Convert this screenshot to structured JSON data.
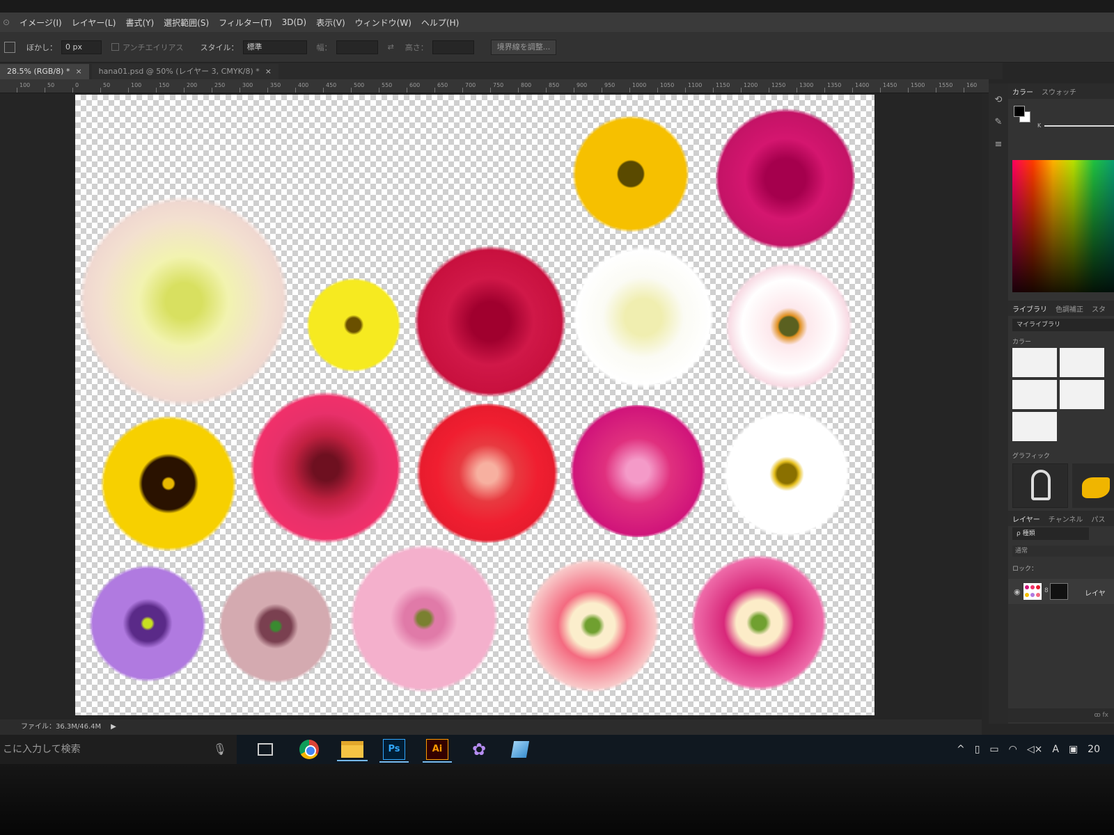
{
  "menu": {
    "items": [
      "イメージ(I)",
      "レイヤー(L)",
      "書式(Y)",
      "選択範囲(S)",
      "フィルター(T)",
      "3D(D)",
      "表示(V)",
      "ウィンドウ(W)",
      "ヘルプ(H)"
    ]
  },
  "options": {
    "feather_label": "ぼかし：",
    "feather_value": "0 px",
    "antialias_label": "アンチエイリアス",
    "style_label": "スタイル：",
    "style_value": "標準",
    "width_label": "幅：",
    "height_label": "高さ：",
    "refine_button": "境界線を調整..."
  },
  "tabs": [
    {
      "label": "28.5% (RGB/8) *",
      "close": "×"
    },
    {
      "label": "hana01.psd @ 50% (レイヤー 3, CMYK/8) *",
      "close": "×"
    }
  ],
  "ruler": [
    "100",
    "50",
    "0",
    "50",
    "100",
    "150",
    "200",
    "250",
    "300",
    "350",
    "400",
    "450",
    "500",
    "550",
    "600",
    "650",
    "700",
    "750",
    "800",
    "850",
    "900",
    "950",
    "1000",
    "1050",
    "1100",
    "1150",
    "1200",
    "1250",
    "1300",
    "1350",
    "1400",
    "1450",
    "1500",
    "1550",
    "160"
  ],
  "status": {
    "file_info": "ファイル：36.3M/46.4M",
    "arrow": "▶"
  },
  "panels": {
    "color_tab": "カラー",
    "swatch_tab": "スウォッチ",
    "k_label": "K",
    "library_tab": "ライブラリ",
    "adjust_tab": "色調補正",
    "style_tab": "スタ",
    "library_select": "マイライブラリ",
    "colors_label": "カラー",
    "graphics_label": "グラフィック",
    "layers_tab": "レイヤー",
    "channels_tab": "チャンネル",
    "paths_tab": "パス",
    "kind_select": "ρ 種類",
    "blend_mode": "通常",
    "lock_label": "ロック：",
    "layer_name": "レイヤ",
    "foot_icons": "ꝏ fx"
  },
  "taskbar": {
    "search_placeholder": "こに入力して検索",
    "ps_label": "Ps",
    "ai_label": "Ai",
    "tray_text": "A",
    "clock_partial": "20"
  },
  "colors": {
    "ps_blue": "#31a8ff",
    "ai_orange": "#ff9a00",
    "canvas_bg": "#ffffff"
  }
}
